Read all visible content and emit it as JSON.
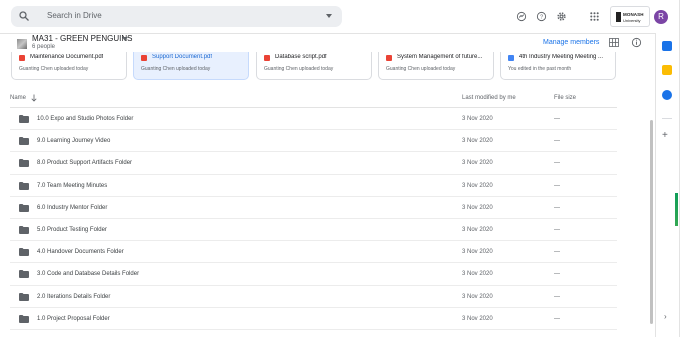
{
  "search": {
    "placeholder": "Search in Drive"
  },
  "header_icons": [
    "offline-status-icon",
    "help-icon",
    "settings-icon",
    "apps-icon"
  ],
  "org": {
    "line1": "MONASH",
    "line2": "University"
  },
  "avatar": {
    "initial": "R",
    "color": "#7b45a5"
  },
  "shared_drive": {
    "title": "MA31 - GREEN PENGUINS",
    "members": "6 people",
    "manage_label": "Manage members"
  },
  "suggested": [
    {
      "title": "Maintenance Document.pdf",
      "sub": "Guanting Chen uploaded today",
      "type": "pdf"
    },
    {
      "title": "Support Document.pdf",
      "sub": "Guanting Chen uploaded today",
      "type": "pdf"
    },
    {
      "title": "Database script.pdf",
      "sub": "Guanting Chen uploaded today",
      "type": "pdf"
    },
    {
      "title": "System Management of future...",
      "sub": "Guanting Chen uploaded today",
      "type": "pdf"
    },
    {
      "title": "4th Industry Meeting Meeting ...",
      "sub": "You edited in the past month",
      "type": "doc"
    }
  ],
  "columns": {
    "name": "Name",
    "modified": "Last modified by me",
    "size": "File size"
  },
  "files": [
    {
      "name": "10.0 Expo and Studio Photos Folder",
      "modified": "3 Nov 2020",
      "size": "—"
    },
    {
      "name": "9.0 Learning Journey Video",
      "modified": "3 Nov 2020",
      "size": "—"
    },
    {
      "name": "8.0 Product Support Artifacts Folder",
      "modified": "3 Nov 2020",
      "size": "—"
    },
    {
      "name": "7.0 Team Meeting Minutes",
      "modified": "3 Nov 2020",
      "size": "—"
    },
    {
      "name": "6.0 Industry Mentor Folder",
      "modified": "3 Nov 2020",
      "size": "—"
    },
    {
      "name": "5.0 Product Testing Folder",
      "modified": "3 Nov 2020",
      "size": "—"
    },
    {
      "name": "4.0 Handover Documents Folder",
      "modified": "3 Nov 2020",
      "size": "—"
    },
    {
      "name": "3.0 Code and Database Details Folder",
      "modified": "3 Nov 2020",
      "size": "—"
    },
    {
      "name": "2.0 Iterations Details Folder",
      "modified": "3 Nov 2020",
      "size": "—"
    },
    {
      "name": "1.0 Project Proposal Folder",
      "modified": "3 Nov 2020",
      "size": "—"
    }
  ],
  "colors": {
    "accent": "#1a73e8",
    "pdf": "#ea4335",
    "doc": "#4285f4",
    "selected": "#e8f0fe"
  }
}
